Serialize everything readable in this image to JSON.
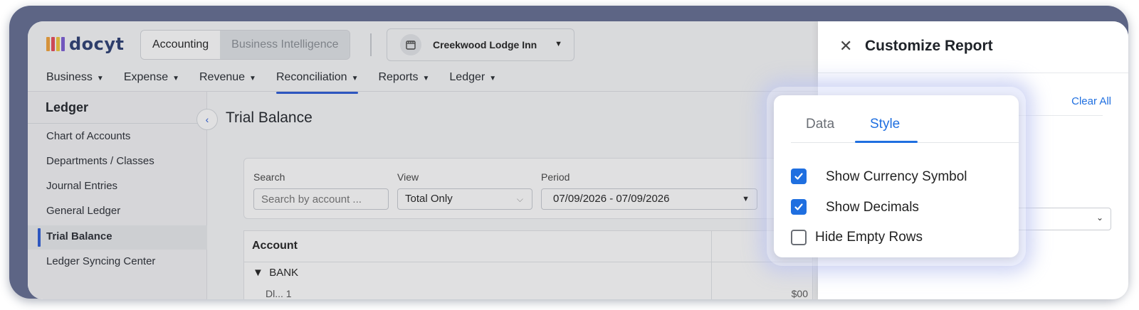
{
  "header": {
    "logo_text": "docyt",
    "mode_tabs": [
      "Accounting",
      "Business Intelligence"
    ],
    "business_name": "Creekwood Lodge Inn"
  },
  "nav": {
    "items": [
      "Business",
      "Expense",
      "Revenue",
      "Reconciliation",
      "Reports",
      "Ledger"
    ],
    "active": "Reconciliation"
  },
  "sidebar": {
    "title": "Ledger",
    "items": [
      "Chart of Accounts",
      "Departments / Classes",
      "Journal Entries",
      "General Ledger",
      "Trial Balance",
      "Ledger Syncing Center"
    ],
    "active": "Trial Balance"
  },
  "main": {
    "title": "Trial Balance",
    "filters": {
      "search_label": "Search",
      "search_placeholder": "Search by account ...",
      "view_label": "View",
      "view_value": "Total Only",
      "period_label": "Period",
      "period_value": "07/09/2026 - 07/09/2026"
    },
    "table": {
      "col_account": "Account",
      "group": "BANK",
      "partial_row": "Dl... 1",
      "partial_amount": "$00"
    }
  },
  "drawer": {
    "title": "Customize Report",
    "clear_all": "Clear All"
  },
  "popover": {
    "tabs": [
      "Data",
      "Style"
    ],
    "active_tab": "Style",
    "options": [
      {
        "label": "Show Currency Symbol",
        "checked": true
      },
      {
        "label": "Show Decimals",
        "checked": true
      },
      {
        "label": "Hide Empty Rows",
        "checked": false
      }
    ]
  },
  "colors": {
    "accent": "#1f6fe0",
    "nav_accent": "#2a5bd7",
    "frame": "#5d6585"
  }
}
